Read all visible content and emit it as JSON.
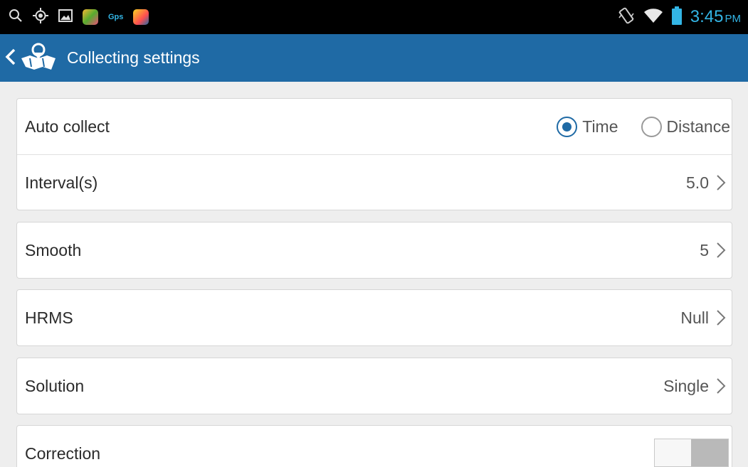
{
  "status_bar": {
    "gps_label": "Gps",
    "time": "3:45",
    "ampm": "PM",
    "icons": [
      "search-icon",
      "location-target-icon",
      "gallery-icon",
      "app-icon",
      "gps-app-icon",
      "app-icon",
      "vibrate-icon",
      "wifi-icon",
      "battery-icon"
    ]
  },
  "action_bar": {
    "title": "Collecting settings",
    "back_icon": "chevron-left-icon",
    "app_icon": "map-pin-icon",
    "color": "#1f6aa5"
  },
  "settings": {
    "auto_collect": {
      "label": "Auto collect",
      "options": [
        "Time",
        "Distance"
      ],
      "selected": "Time"
    },
    "interval": {
      "label": "Interval(s)",
      "value": "5.0"
    },
    "smooth": {
      "label": "Smooth",
      "value": "5"
    },
    "hrms": {
      "label": "HRMS",
      "value": "Null"
    },
    "solution": {
      "label": "Solution",
      "value": "Single"
    },
    "correction": {
      "label": "Correction",
      "enabled": false
    }
  },
  "colors": {
    "accent": "#1f6aa5",
    "status_text": "#33b5e5",
    "background": "#eeeeee"
  }
}
